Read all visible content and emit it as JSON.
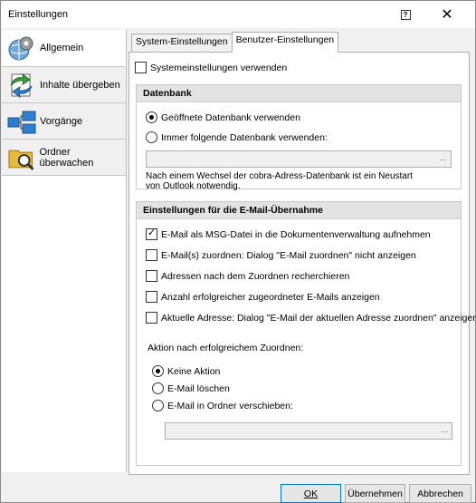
{
  "window": {
    "title": "Einstellungen",
    "help_label": "?",
    "close_label": "✕"
  },
  "sidebar": {
    "items": [
      {
        "label": "Allgemein"
      },
      {
        "label": "Inhalte übergeben"
      },
      {
        "label": "Vorgänge"
      },
      {
        "label": "Ordner überwachen"
      }
    ]
  },
  "tabs": [
    {
      "label": "System-Einstellungen"
    },
    {
      "label": "Benutzer-Einstellungen"
    }
  ],
  "content": {
    "use_system_settings": {
      "label": "Systemeinstellungen verwenden",
      "checked": false
    },
    "database_group": {
      "title": "Datenbank",
      "radio_open": {
        "label": "Geöffnete Datenbank verwenden",
        "checked": true
      },
      "radio_always": {
        "label": "Immer folgende Datenbank verwenden:",
        "checked": false
      },
      "path_value": "",
      "path_browse": "...",
      "note_line1": "Nach einem Wechsel der cobra-Adress-Datenbank ist ein Neustart",
      "note_line2": "von Outlook notwendig."
    },
    "email_group": {
      "title": "Einstellungen für die E-Mail-Übernahme",
      "options": [
        {
          "label": "E-Mail als MSG-Datei in die Dokumentenverwaltung aufnehmen",
          "checked": true
        },
        {
          "label": "E-Mail(s) zuordnen: Dialog \"E-Mail zuordnen\" nicht anzeigen",
          "checked": false
        },
        {
          "label": "Adressen nach dem Zuordnen recherchieren",
          "checked": false
        },
        {
          "label": "Anzahl erfolgreicher zugeordneter E-Mails anzeigen",
          "checked": false
        },
        {
          "label": "Aktuelle Adresse: Dialog \"E-Mail der aktuellen Adresse zuordnen\" anzeigen",
          "checked": false
        }
      ],
      "action_label": "Aktion nach erfolgreichem Zuordnen:",
      "actions": [
        {
          "label": "Keine Aktion",
          "checked": true
        },
        {
          "label": "E-Mail löschen",
          "checked": false
        },
        {
          "label": "E-Mail in Ordner verschieben:",
          "checked": false
        }
      ],
      "folder_path": "",
      "folder_browse": "..."
    }
  },
  "buttons": {
    "ok": "OK",
    "apply": "Übernehmen",
    "cancel": "Abbrechen"
  }
}
